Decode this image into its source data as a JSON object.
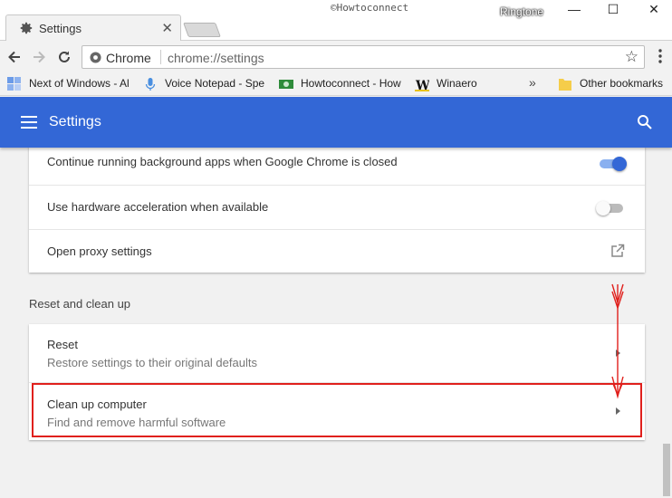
{
  "window": {
    "watermark": "©Howtoconnect",
    "user_label": "Ringtone",
    "minimize": "—",
    "maximize": "☐",
    "close": "✕"
  },
  "tab": {
    "title": "Settings",
    "close": "✕",
    "icon": "gear-icon"
  },
  "toolbar": {
    "site_label": "Chrome",
    "url": "chrome://settings",
    "star": "☆"
  },
  "bookmarks": {
    "items": [
      {
        "label": "Next of Windows - Al",
        "icon": "windows-tiles-icon"
      },
      {
        "label": "Voice Notepad - Spe",
        "icon": "microphone-icon"
      },
      {
        "label": "Howtoconnect - How",
        "icon": "howtoconnect-icon"
      },
      {
        "label": "Winaero",
        "icon": "winaero-icon"
      }
    ],
    "more": "»",
    "other": "Other bookmarks"
  },
  "header": {
    "title": "Settings"
  },
  "system_card": {
    "rows": [
      {
        "label": "Continue running background apps when Google Chrome is closed",
        "toggle": "on"
      },
      {
        "label": "Use hardware acceleration when available",
        "toggle": "off"
      },
      {
        "label": "Open proxy settings",
        "action": "external-link-icon"
      }
    ]
  },
  "reset_section": {
    "title": "Reset and clean up",
    "rows": [
      {
        "label": "Reset",
        "sublabel": "Restore settings to their original defaults"
      },
      {
        "label": "Clean up computer",
        "sublabel": "Find and remove harmful software"
      }
    ]
  },
  "colors": {
    "header_blue": "#3367d6",
    "annotation_red": "#e0201c",
    "toggle_on": "#3367d6"
  }
}
